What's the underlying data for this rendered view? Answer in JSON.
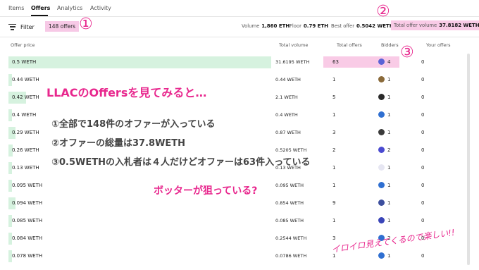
{
  "tabs": [
    {
      "label": "Items"
    },
    {
      "label": "Offers"
    },
    {
      "label": "Analytics"
    },
    {
      "label": "Activity"
    }
  ],
  "toolbar": {
    "filter_label": "Filter",
    "offers_count": "148 offers",
    "stats": [
      {
        "label": "Volume",
        "value": "1,860 ETH"
      },
      {
        "label": "Floor",
        "value": "0.79 ETH"
      },
      {
        "label": "Best offer",
        "value": "0.5042 WETH"
      },
      {
        "label": "Total offer volume",
        "value": "37.8182 WETH"
      }
    ]
  },
  "table": {
    "columns": [
      "Offer price",
      "Total volume",
      "Total offers",
      "Bidders",
      "Your offers"
    ],
    "rows": [
      {
        "price": "0.5 WETH",
        "volume": "31.6195 WETH",
        "offers": "63",
        "bidders": "4",
        "yours": "0",
        "bar": 1.0,
        "avatar_color": "#5b63d6"
      },
      {
        "price": "0.44 WETH",
        "volume": "0.44 WETH",
        "offers": "1",
        "bidders": "1",
        "yours": "0",
        "bar": 0.014,
        "avatar_color": "#8a6a3a"
      },
      {
        "price": "0.42 WETH",
        "volume": "2.1 WETH",
        "offers": "5",
        "bidders": "1",
        "yours": "0",
        "bar": 0.066,
        "avatar_color": "#2a2a2a"
      },
      {
        "price": "0.4 WETH",
        "volume": "0.4 WETH",
        "offers": "1",
        "bidders": "1",
        "yours": "0",
        "bar": 0.013,
        "avatar_color": "#2f6fd1"
      },
      {
        "price": "0.29 WETH",
        "volume": "0.87 WETH",
        "offers": "3",
        "bidders": "1",
        "yours": "0",
        "bar": 0.027,
        "avatar_color": "#3a3a3a"
      },
      {
        "price": "0.26 WETH",
        "volume": "0.5205 WETH",
        "offers": "2",
        "bidders": "2",
        "yours": "0",
        "bar": 0.016,
        "avatar_color": "#4a4ad0"
      },
      {
        "price": "0.13 WETH",
        "volume": "0.13 WETH",
        "offers": "1",
        "bidders": "1",
        "yours": "0",
        "bar": 0.004,
        "avatar_color": "#e6e6f2"
      },
      {
        "price": "0.095 WETH",
        "volume": "0.095 WETH",
        "offers": "1",
        "bidders": "1",
        "yours": "0",
        "bar": 0.003,
        "avatar_color": "#2f6fd1"
      },
      {
        "price": "0.094 WETH",
        "volume": "0.854 WETH",
        "offers": "9",
        "bidders": "1",
        "yours": "0",
        "bar": 0.027,
        "avatar_color": "#3d4f9e"
      },
      {
        "price": "0.085 WETH",
        "volume": "0.085 WETH",
        "offers": "1",
        "bidders": "1",
        "yours": "0",
        "bar": 0.003,
        "avatar_color": "#3a45b8"
      },
      {
        "price": "0.084 WETH",
        "volume": "0.2544 WETH",
        "offers": "3",
        "bidders": "2",
        "yours": "0",
        "bar": 0.008,
        "avatar_color": "#2f6fd1"
      },
      {
        "price": "0.078 WETH",
        "volume": "0.0786 WETH",
        "offers": "1",
        "bidders": "1",
        "yours": "0",
        "bar": 0.002,
        "avatar_color": "#2f6fd1"
      }
    ]
  },
  "annotations": {
    "circle1": "①",
    "circle2": "②",
    "circle3": "③",
    "headline": "LLACのOffersを見てみると…",
    "point1": "①全部で148件のオファーが入っている",
    "point2": "②オファーの総量は37.8WETH",
    "point3": "③0.5WETHの入札者は４人だけどオファーは63件入っている",
    "bots": "ボッターが狙っている?",
    "fun": "イロイロ見えてくるので楽しい!!"
  },
  "colors": {
    "accent_pink": "#e8288e",
    "highlight_pink": "#f9cbe6",
    "bar_green": "#d6f2df"
  }
}
